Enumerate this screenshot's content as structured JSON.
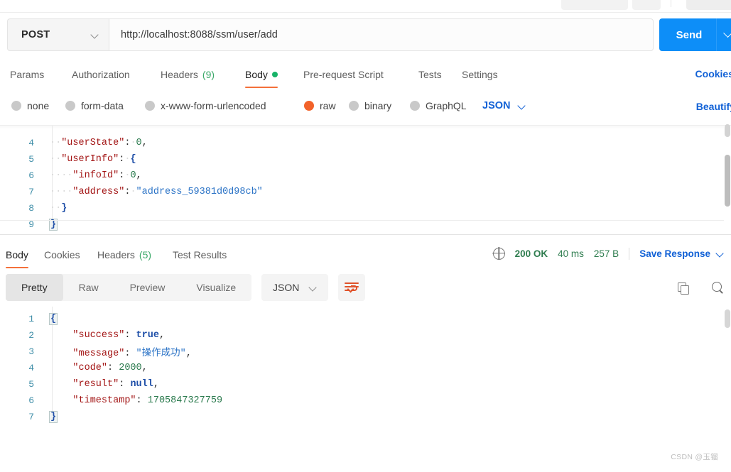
{
  "top_toolbar": {
    "ghost_note": ""
  },
  "request": {
    "method": "POST",
    "url": "http://localhost:8088/ssm/user/add",
    "send_label": "Send",
    "tabs": [
      {
        "label": "Params",
        "active": false
      },
      {
        "label": "Authorization",
        "active": false
      },
      {
        "label": "Headers",
        "count": "(9)",
        "active": false
      },
      {
        "label": "Body",
        "active": true,
        "dot": true
      },
      {
        "label": "Pre-request Script",
        "active": false
      },
      {
        "label": "Tests",
        "active": false
      },
      {
        "label": "Settings",
        "active": false
      }
    ],
    "cookies_link": "Cookies",
    "beautify_link": "Beautify",
    "body_types": [
      {
        "label": "none",
        "selected": false
      },
      {
        "label": "form-data",
        "selected": false
      },
      {
        "label": "x-www-form-urlencoded",
        "selected": false
      },
      {
        "label": "raw",
        "selected": true
      },
      {
        "label": "binary",
        "selected": false
      },
      {
        "label": "GraphQL",
        "selected": false
      }
    ],
    "raw_format": "JSON",
    "body_lines": [
      {
        "no": "4",
        "text": "  \"userState\": 0,"
      },
      {
        "no": "5",
        "text": "  \"userInfo\": {"
      },
      {
        "no": "6",
        "text": "    \"infoId\": 0,"
      },
      {
        "no": "7",
        "text": "    \"address\": \"address_59381d0d98cb\""
      },
      {
        "no": "8",
        "text": "  }"
      },
      {
        "no": "9",
        "text": "}"
      }
    ]
  },
  "response": {
    "tabs": [
      {
        "label": "Body",
        "active": true
      },
      {
        "label": "Cookies",
        "active": false
      },
      {
        "label": "Headers",
        "count": "(5)",
        "active": false
      },
      {
        "label": "Test Results",
        "active": false
      }
    ],
    "status_code": "200 OK",
    "time": "40 ms",
    "size": "257 B",
    "save_response": "Save Response",
    "view_modes": [
      {
        "label": "Pretty",
        "active": true
      },
      {
        "label": "Raw",
        "active": false
      },
      {
        "label": "Preview",
        "active": false
      },
      {
        "label": "Visualize",
        "active": false
      }
    ],
    "format": "JSON",
    "icons": {
      "wrap": "word-wrap-icon",
      "copy": "copy-icon",
      "search": "search-icon"
    },
    "body_lines": [
      {
        "no": "1",
        "text": "{"
      },
      {
        "no": "2",
        "text": "    \"success\": true,"
      },
      {
        "no": "3",
        "text": "    \"message\": \"操作成功\","
      },
      {
        "no": "4",
        "text": "    \"code\": 2000,"
      },
      {
        "no": "5",
        "text": "    \"result\": null,"
      },
      {
        "no": "6",
        "text": "    \"timestamp\": 1705847327759"
      },
      {
        "no": "7",
        "text": "}"
      }
    ],
    "json_values": {
      "success": "true",
      "message": "操作成功",
      "code": "2000",
      "result": "null",
      "timestamp": "1705847327759"
    }
  },
  "watermark": "CSDN @玉镏",
  "colors": {
    "send_blue": "#0d8ef8",
    "link_blue": "#1161d6",
    "accent_orange": "#f4703a",
    "raw_orange": "#f2622a",
    "status_green": "#2f7d4f",
    "dot_green": "#18b368"
  }
}
